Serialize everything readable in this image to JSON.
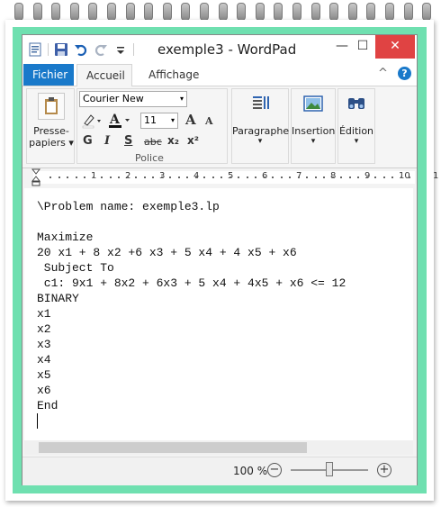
{
  "window": {
    "title": "exemple3 - WordPad",
    "minimize_glyph": "—",
    "maximize_glyph": "☐",
    "close_glyph": "✕"
  },
  "ribbon": {
    "tabs": [
      {
        "label": "Fichier"
      },
      {
        "label": "Accueil"
      },
      {
        "label": "Affichage"
      }
    ],
    "collapse_glyph": "^",
    "help_glyph": "?",
    "clipboard": {
      "line1": "Presse-",
      "line2": "papiers ▾"
    },
    "font": {
      "family": "Courier New",
      "size": "11",
      "group_label": "Police",
      "grow_glyph": "A",
      "shrink_glyph": "A",
      "bold": "G",
      "italic": "I",
      "underline": "S",
      "strike": "abc",
      "subscript": "x₂",
      "superscript": "x²"
    },
    "paragraph": {
      "label": "Paragraphe",
      "arrow": "▾"
    },
    "insert": {
      "label": "Insertion",
      "arrow": "▾"
    },
    "edit": {
      "label": "Édition",
      "arrow": "▾"
    },
    "combo_arrow": "▾"
  },
  "ruler": {
    "labels": [
      "1",
      "2",
      "3",
      "4",
      "5",
      "6",
      "7",
      "8",
      "9",
      "10",
      "1"
    ]
  },
  "document": {
    "lines": [
      "\\Problem name: exemple3.lp",
      "",
      "Maximize",
      "20 x1 + 8 x2 +6 x3 + 5 x4 + 4 x5 + x6",
      " Subject To",
      " c1: 9x1 + 8x2 + 6x3 + 5 x4 + 4x5 + x6 <= 12",
      "BINARY",
      "x1",
      "x2",
      "x3",
      "x4",
      "x5",
      "x6",
      "End"
    ]
  },
  "status": {
    "zoom": "100 %",
    "zoom_out": "−",
    "zoom_in": "+",
    "zoom_slider_fraction": 0.5
  },
  "colors": {
    "frame": "#6fe0b0",
    "file_tab": "#1979ca",
    "close_button": "#e04343"
  }
}
